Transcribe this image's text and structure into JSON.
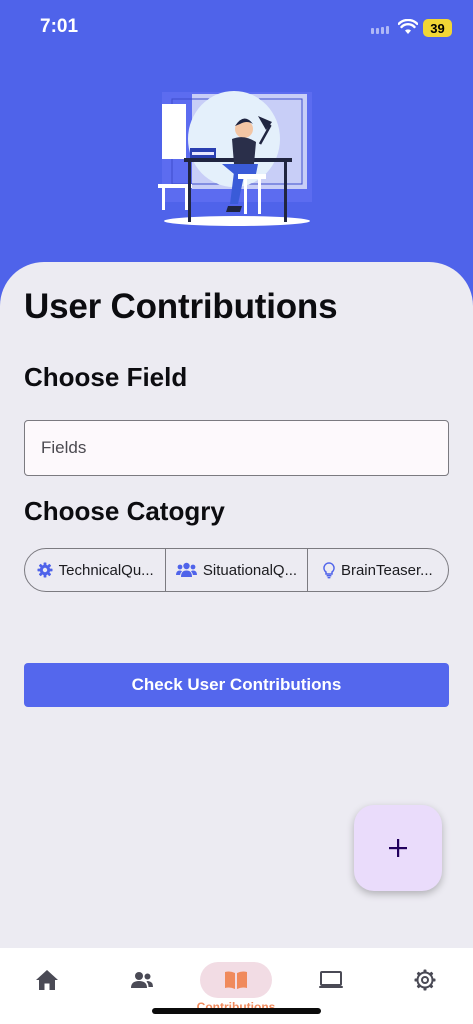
{
  "status_bar": {
    "time": "7:01",
    "battery": "39"
  },
  "page": {
    "title": "User Contributions",
    "choose_field_label": "Choose Field",
    "fields_placeholder": "Fields",
    "choose_category_label": "Choose Catogry",
    "categories": [
      {
        "label": "TechnicalQu...",
        "icon": "gear-icon"
      },
      {
        "label": "SituationalQ...",
        "icon": "users-icon"
      },
      {
        "label": "BrainTeaser...",
        "icon": "lightbulb-icon"
      }
    ],
    "check_button_label": "Check User Contributions",
    "fab_label": "+"
  },
  "bottom_nav": {
    "items": [
      {
        "icon": "home-icon"
      },
      {
        "icon": "users-icon"
      },
      {
        "icon": "book-icon",
        "label": "Contributions",
        "active": true
      },
      {
        "icon": "monitor-icon"
      },
      {
        "icon": "settings-icon"
      }
    ]
  },
  "colors": {
    "header_background": "#4f63ea",
    "card_background": "#ecebf2",
    "button_background": "#5467ed",
    "fab_background": "#eadcfb",
    "active_nav_pill": "#f2dce4",
    "active_nav_icon": "#f08a5c"
  }
}
